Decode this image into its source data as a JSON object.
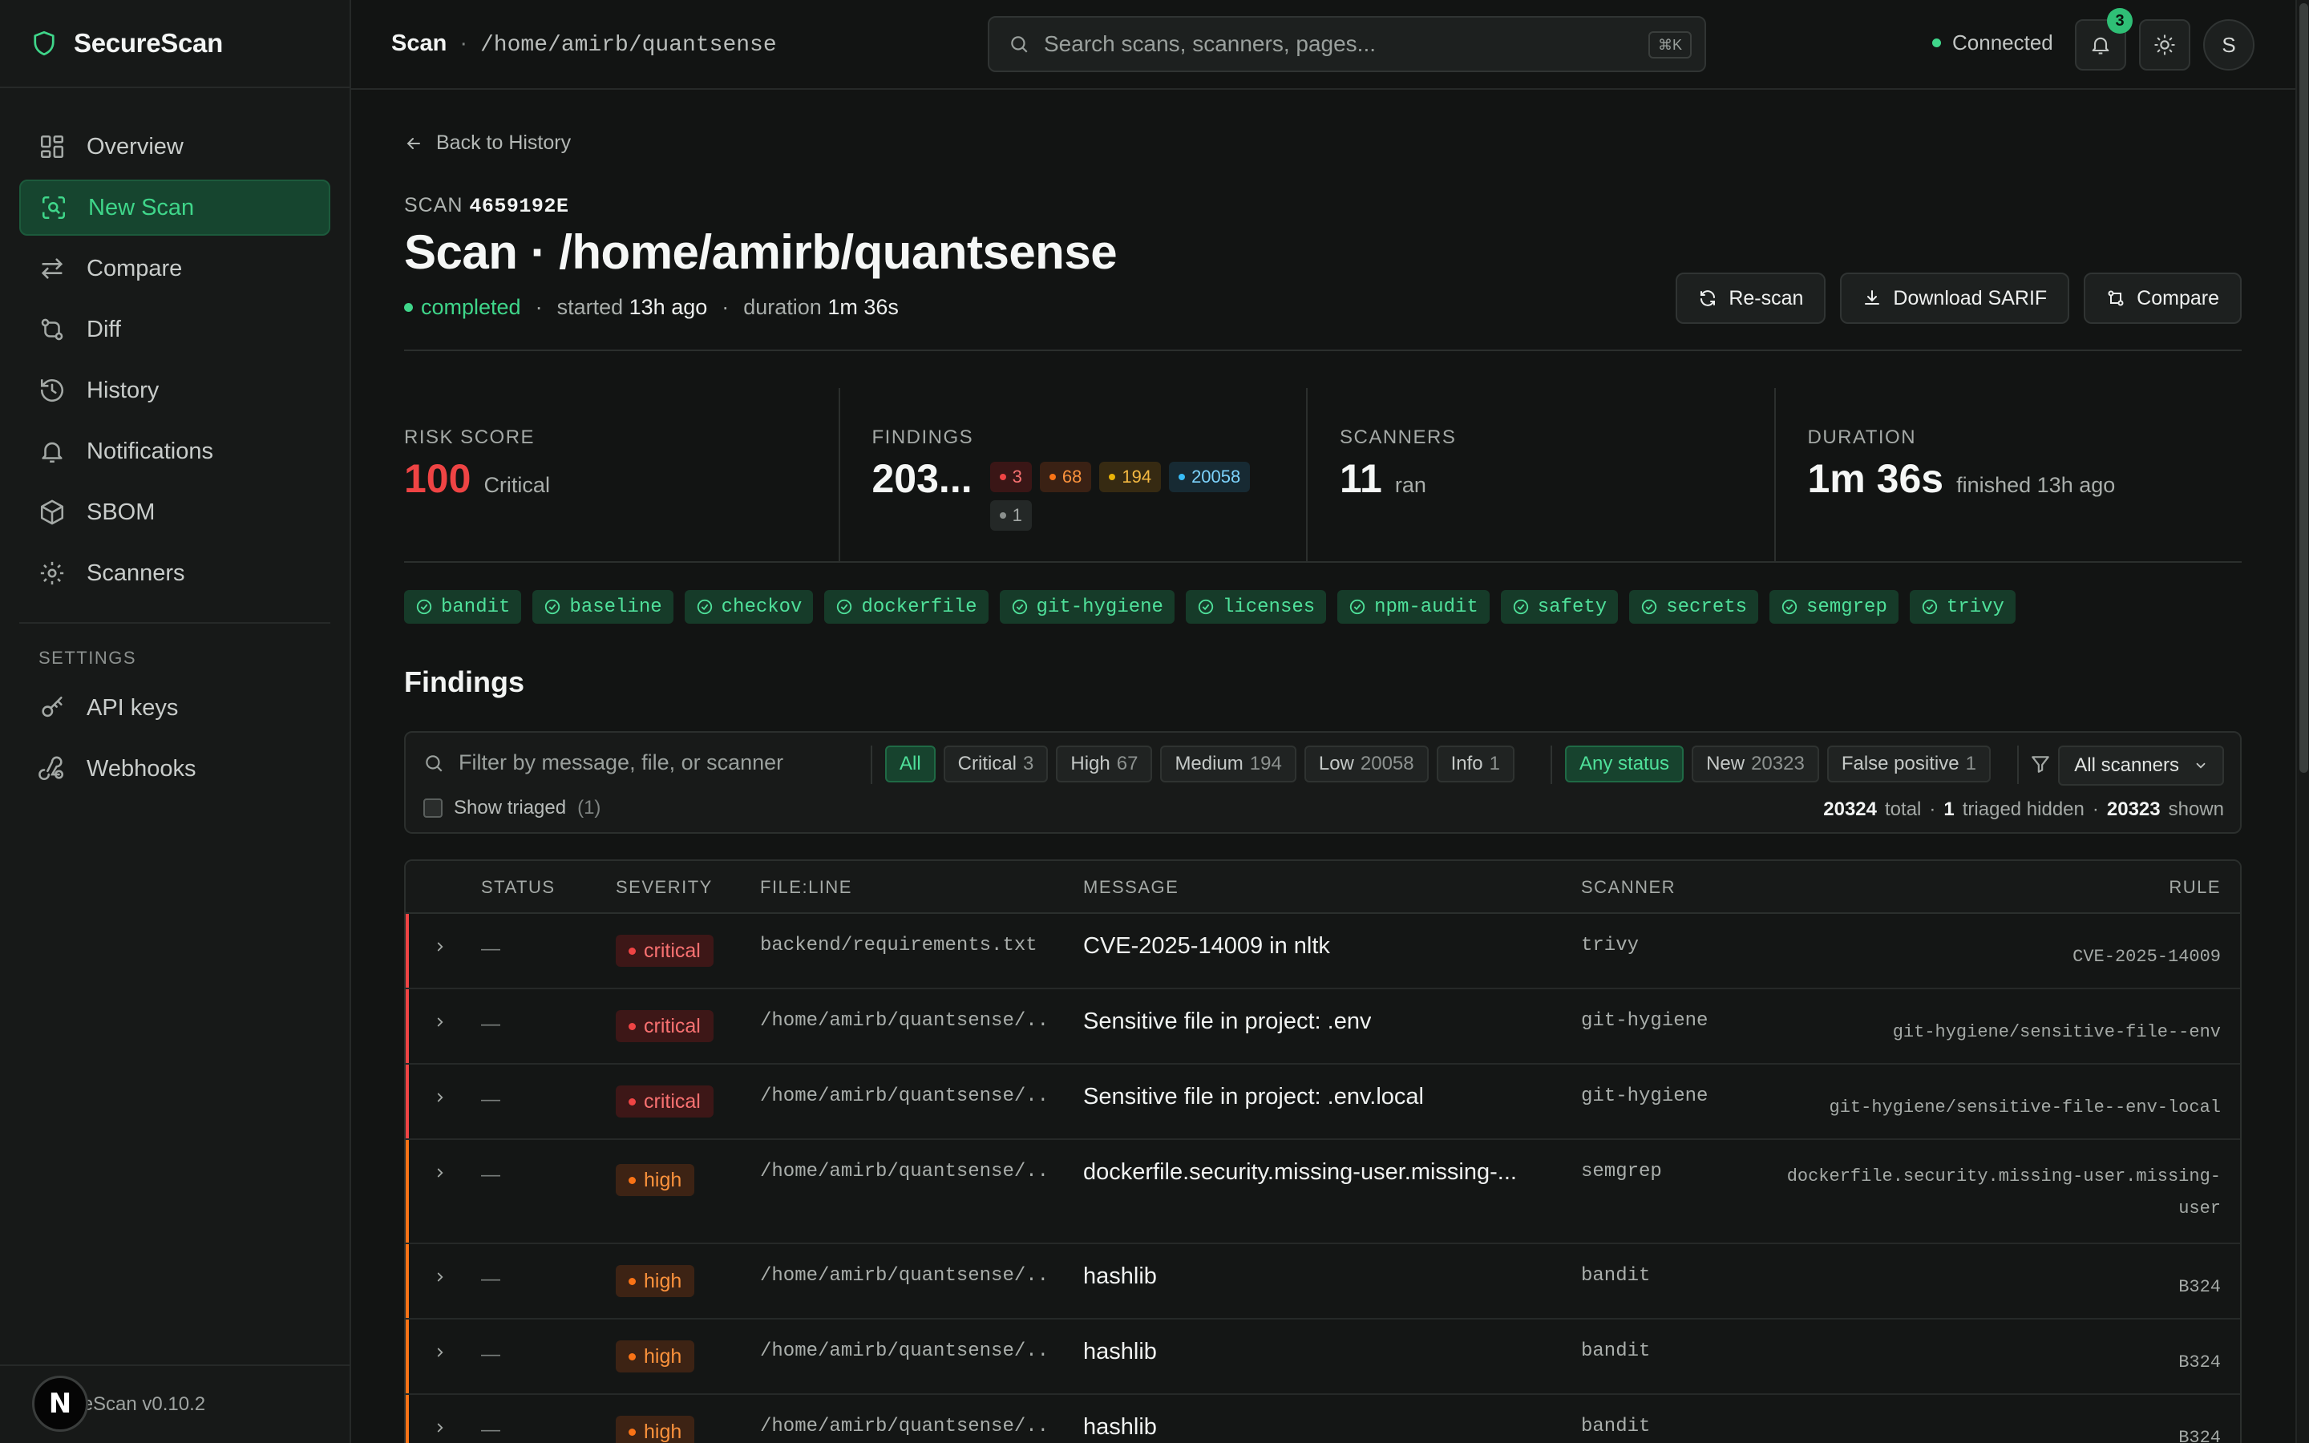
{
  "app": {
    "name": "SecureScan",
    "version": "SecureScan v0.10.2"
  },
  "nav": [
    {
      "label": "Overview",
      "icon": "grid-icon",
      "active": false
    },
    {
      "label": "New Scan",
      "icon": "scan-icon",
      "active": true
    },
    {
      "label": "Compare",
      "icon": "arrows-icon",
      "active": false
    },
    {
      "label": "Diff",
      "icon": "git-diff-icon",
      "active": false
    },
    {
      "label": "History",
      "icon": "history-icon",
      "active": false
    },
    {
      "label": "Notifications",
      "icon": "bell-icon",
      "active": false
    },
    {
      "label": "SBOM",
      "icon": "box-icon",
      "active": false
    },
    {
      "label": "Scanners",
      "icon": "gear-icon",
      "active": false
    }
  ],
  "settings": {
    "label": "SETTINGS",
    "items": [
      {
        "label": "API keys",
        "icon": "key-icon"
      },
      {
        "label": "Webhooks",
        "icon": "webhook-icon"
      }
    ]
  },
  "topbar": {
    "title": "Scan",
    "sep": "·",
    "path": "/home/amirb/quantsense",
    "search_placeholder": "Search scans, scanners, pages...",
    "shortcut": "⌘K",
    "connection": "Connected",
    "notif_count": "3",
    "avatar": "S"
  },
  "scan": {
    "back": "Back to History",
    "id_label": "SCAN",
    "id": "4659192E",
    "title": "Scan · /home/amirb/quantsense",
    "status": "completed",
    "sep": "·",
    "started_label": "started",
    "started": "13h ago",
    "duration_label": "duration",
    "duration": "1m 36s",
    "actions": [
      "Re-scan",
      "Download SARIF",
      "Compare"
    ]
  },
  "stats": {
    "risk": {
      "label": "RISK SCORE",
      "value": "100",
      "sub": "Critical"
    },
    "findings": {
      "label": "FINDINGS",
      "value": "203...",
      "critical": "3",
      "high": "68",
      "medium": "194",
      "low": "20058",
      "info": "1"
    },
    "scanners": {
      "label": "SCANNERS",
      "value": "11",
      "sub": "ran"
    },
    "duration": {
      "label": "DURATION",
      "value": "1m 36s",
      "sub": "finished 13h ago"
    }
  },
  "scanner_chips": [
    "bandit",
    "baseline",
    "checkov",
    "dockerfile",
    "git-hygiene",
    "licenses",
    "npm-audit",
    "safety",
    "secrets",
    "semgrep",
    "trivy"
  ],
  "findings_section": {
    "title": "Findings",
    "filter_placeholder": "Filter by message, file, or scanner",
    "severity_filters": [
      {
        "label": "All",
        "count": ""
      },
      {
        "label": "Critical",
        "count": "3"
      },
      {
        "label": "High",
        "count": "67"
      },
      {
        "label": "Medium",
        "count": "194"
      },
      {
        "label": "Low",
        "count": "20058"
      },
      {
        "label": "Info",
        "count": "1"
      }
    ],
    "status_filters": [
      {
        "label": "Any status",
        "count": ""
      },
      {
        "label": "New",
        "count": "20323"
      },
      {
        "label": "False positive",
        "count": "1"
      }
    ],
    "scanner_select": "All scanners",
    "show_triaged": "Show triaged",
    "triaged_count": "(1)",
    "total": "20324",
    "total_label": "total",
    "hidden": "1",
    "hidden_label": "triaged hidden",
    "shown": "20323",
    "shown_label": "shown",
    "dot": "·"
  },
  "table": {
    "headers": [
      "STATUS",
      "SEVERITY",
      "FILE:LINE",
      "MESSAGE",
      "SCANNER",
      "RULE"
    ],
    "rows": [
      {
        "status": "—",
        "severity": "critical",
        "file": "backend/requirements.txt",
        "message": "CVE-2025-14009 in nltk",
        "scanner": "trivy",
        "rule": "CVE-2025-14009"
      },
      {
        "status": "—",
        "severity": "critical",
        "file": "/home/amirb/quantsense/...",
        "message": "Sensitive file in project: .env",
        "scanner": "git-hygiene",
        "rule": "git-hygiene/sensitive-file--env"
      },
      {
        "status": "—",
        "severity": "critical",
        "file": "/home/amirb/quantsense/...",
        "message": "Sensitive file in project: .env.local",
        "scanner": "git-hygiene",
        "rule": "git-hygiene/sensitive-file--env-local"
      },
      {
        "status": "—",
        "severity": "high",
        "file": "/home/amirb/quantsense/...",
        "message": "dockerfile.security.missing-user.missing-...",
        "scanner": "semgrep",
        "rule": "dockerfile.security.missing-user.missing-user"
      },
      {
        "status": "—",
        "severity": "high",
        "file": "/home/amirb/quantsense/...",
        "message": "hashlib",
        "scanner": "bandit",
        "rule": "B324"
      },
      {
        "status": "—",
        "severity": "high",
        "file": "/home/amirb/quantsense/...",
        "message": "hashlib",
        "scanner": "bandit",
        "rule": "B324"
      },
      {
        "status": "—",
        "severity": "high",
        "file": "/home/amirb/quantsense/...",
        "message": "hashlib",
        "scanner": "bandit",
        "rule": "B324"
      }
    ]
  },
  "colors": {
    "accent": "#3fd68a",
    "critical": "#ef4444",
    "high": "#f97316",
    "medium": "#eab308",
    "low": "#38bdf8",
    "background": "#121413"
  }
}
